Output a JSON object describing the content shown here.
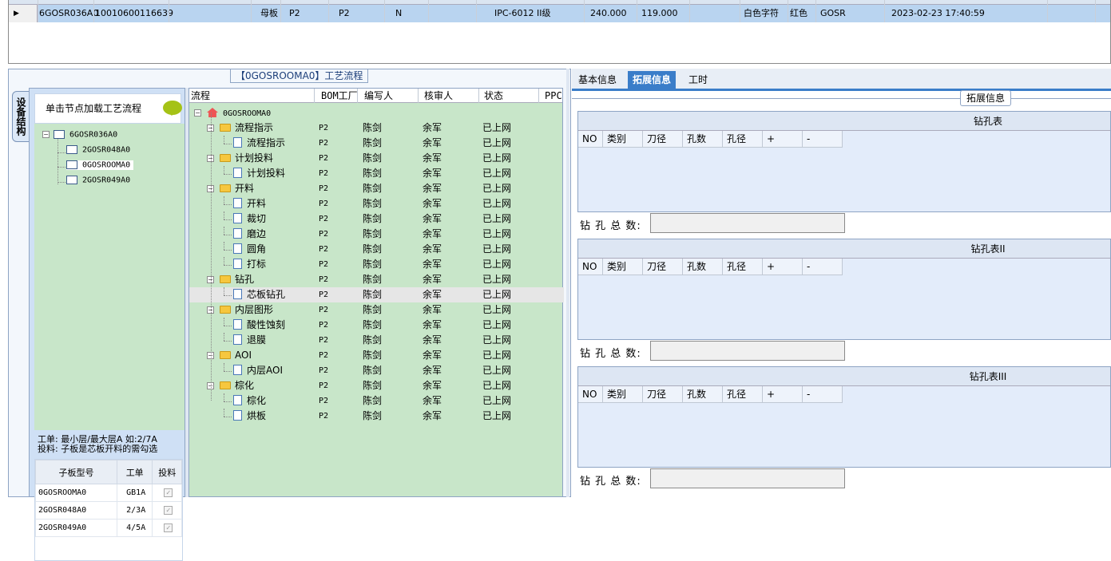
{
  "top_grid": {
    "row": [
      "6GOSR036A0",
      "10010600116639",
      "母板",
      "P2",
      "P2",
      "N",
      "IPC-6012 II级",
      "240.000",
      "119.000",
      "白色字符",
      "红色",
      "GOSR",
      "2023-02-23 17:40:59"
    ]
  },
  "frame_title": "【0GOSROOMA0】工艺流程",
  "vertical_tab": "设备结构",
  "device": {
    "header": "单击节点加载工艺流程",
    "tree": [
      "6GOSR036A0",
      "2GOSR048A0",
      "0GOSROOMA0",
      "2GOSR049A0"
    ],
    "note_line1": "工单: 最小层/最大层A 如:2/7A",
    "note_line2": "投料: 子板是芯板开料的需勾选",
    "sub_headers": [
      "子板型号",
      "工单",
      "投料"
    ],
    "sub_rows": [
      [
        "0GOSROOMA0",
        "GB1A",
        "✓"
      ],
      [
        "2GOSR048A0",
        "2/3A",
        "✓"
      ],
      [
        "2GOSR049A0",
        "4/5A",
        "✓"
      ]
    ]
  },
  "process": {
    "headers": [
      "流程",
      "BOM工厂",
      "编写人",
      "核审人",
      "状态",
      "PPC"
    ],
    "root": "0GOSROOMA0",
    "rows": [
      {
        "name": "流程指示",
        "level": 1,
        "factory": "P2",
        "writer": "陈剑",
        "reviewer": "余军",
        "status": "已上网"
      },
      {
        "name": "流程指示",
        "level": 2,
        "factory": "P2",
        "writer": "陈剑",
        "reviewer": "余军",
        "status": "已上网"
      },
      {
        "name": "计划投料",
        "level": 1,
        "factory": "P2",
        "writer": "陈剑",
        "reviewer": "余军",
        "status": "已上网"
      },
      {
        "name": "计划投料",
        "level": 2,
        "factory": "P2",
        "writer": "陈剑",
        "reviewer": "余军",
        "status": "已上网"
      },
      {
        "name": "开料",
        "level": 1,
        "factory": "P2",
        "writer": "陈剑",
        "reviewer": "余军",
        "status": "已上网"
      },
      {
        "name": "开料",
        "level": 2,
        "factory": "P2",
        "writer": "陈剑",
        "reviewer": "余军",
        "status": "已上网"
      },
      {
        "name": "裁切",
        "level": 2,
        "factory": "P2",
        "writer": "陈剑",
        "reviewer": "余军",
        "status": "已上网"
      },
      {
        "name": "磨边",
        "level": 2,
        "factory": "P2",
        "writer": "陈剑",
        "reviewer": "余军",
        "status": "已上网"
      },
      {
        "name": "圆角",
        "level": 2,
        "factory": "P2",
        "writer": "陈剑",
        "reviewer": "余军",
        "status": "已上网"
      },
      {
        "name": "打标",
        "level": 2,
        "factory": "P2",
        "writer": "陈剑",
        "reviewer": "余军",
        "status": "已上网"
      },
      {
        "name": "钻孔",
        "level": 1,
        "factory": "P2",
        "writer": "陈剑",
        "reviewer": "余军",
        "status": "已上网"
      },
      {
        "name": "芯板钻孔",
        "level": 2,
        "factory": "P2",
        "writer": "陈剑",
        "reviewer": "余军",
        "status": "已上网"
      },
      {
        "name": "内层图形",
        "level": 1,
        "factory": "P2",
        "writer": "陈剑",
        "reviewer": "余军",
        "status": "已上网"
      },
      {
        "name": "酸性蚀刻",
        "level": 2,
        "factory": "P2",
        "writer": "陈剑",
        "reviewer": "余军",
        "status": "已上网"
      },
      {
        "name": "退膜",
        "level": 2,
        "factory": "P2",
        "writer": "陈剑",
        "reviewer": "余军",
        "status": "已上网"
      },
      {
        "name": "AOI",
        "level": 1,
        "factory": "P2",
        "writer": "陈剑",
        "reviewer": "余军",
        "status": "已上网"
      },
      {
        "name": "内层AOI",
        "level": 2,
        "factory": "P2",
        "writer": "陈剑",
        "reviewer": "余军",
        "status": "已上网"
      },
      {
        "name": "棕化",
        "level": 1,
        "factory": "P2",
        "writer": "陈剑",
        "reviewer": "余军",
        "status": "已上网"
      },
      {
        "name": "棕化",
        "level": 2,
        "factory": "P2",
        "writer": "陈剑",
        "reviewer": "余军",
        "status": "已上网"
      },
      {
        "name": "烘板",
        "level": 2,
        "factory": "P2",
        "writer": "陈剑",
        "reviewer": "余军",
        "status": "已上网"
      }
    ]
  },
  "right": {
    "tabs": [
      "基本信息",
      "拓展信息",
      "工时"
    ],
    "active_tab": "拓展信息",
    "legend": "拓展信息",
    "sections": [
      {
        "title": "钻孔表",
        "total_label": "钻 孔 总 数:"
      },
      {
        "title": "钻孔表II",
        "total_label": "钻 孔 总 数:"
      },
      {
        "title": "钻孔表III",
        "total_label": "钻 孔 总 数:"
      }
    ],
    "columns": [
      "NO",
      "类别",
      "刀径",
      "孔数",
      "孔径",
      "+",
      "-"
    ]
  }
}
